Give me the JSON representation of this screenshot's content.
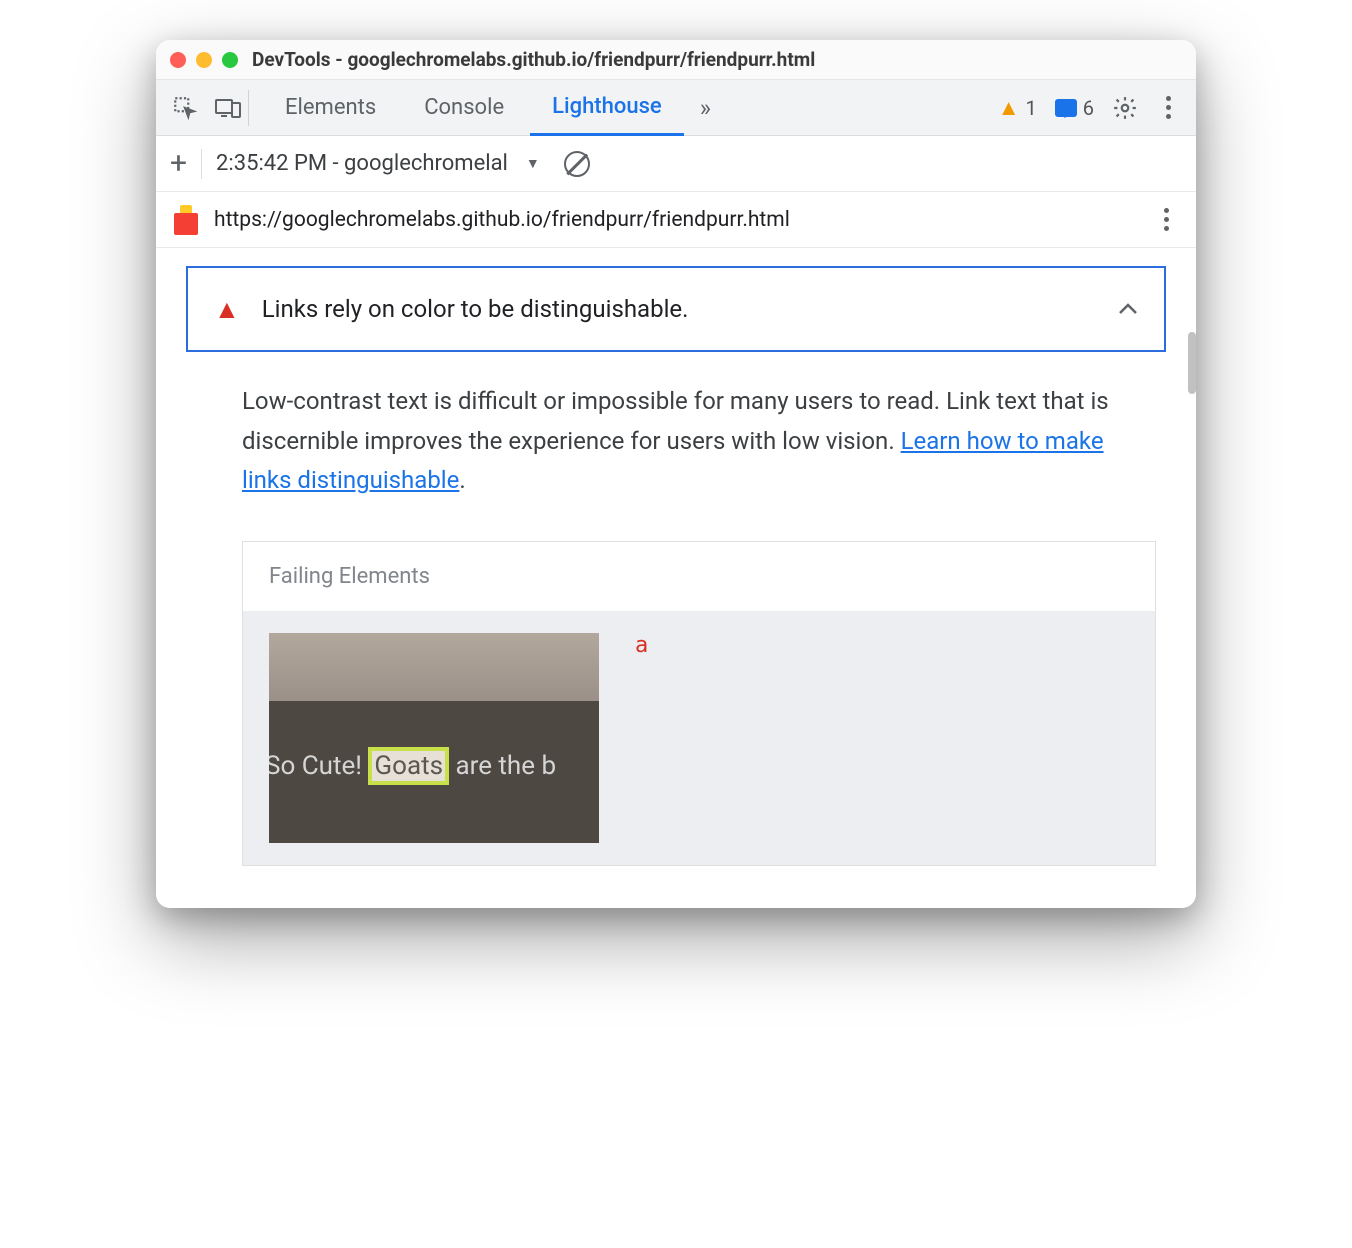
{
  "titlebar": {
    "title": "DevTools - googlechromelabs.github.io/friendpurr/friendpurr.html"
  },
  "tabs": {
    "items": [
      "Elements",
      "Console",
      "Lighthouse"
    ],
    "active_index": 2,
    "more_glyph": "»",
    "warnings": "1",
    "messages": "6"
  },
  "report_toolbar": {
    "label": "2:35:42 PM - googlechromelal"
  },
  "url_row": {
    "url": "https://googlechromelabs.github.io/friendpurr/friendpurr.html"
  },
  "audit": {
    "title": "Links rely on color to be distinguishable.",
    "description_pre": "Low-contrast text is difficult or impossible for many users to read. Link text that is discernible improves the experience for users with low vision. ",
    "learn_link": "Learn how to make links distinguishable",
    "description_post": "."
  },
  "failing": {
    "header": "Failing Elements",
    "element_tag": "a",
    "thumb_text_pre": "So Cute! ",
    "thumb_text_highlight": "Goats",
    "thumb_text_post": " are the b"
  }
}
